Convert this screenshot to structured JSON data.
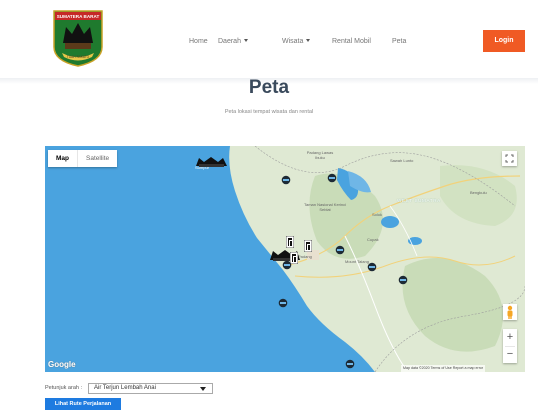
{
  "logo": {
    "banner_text": "SUMATERA BARAT",
    "ribbon_text": "TUAH SAKATO"
  },
  "nav": {
    "home": "Home",
    "daerah": "Daerah",
    "wisata": "Wisata",
    "rental": "Rental Mobil",
    "peta": "Peta",
    "login": "Login"
  },
  "page": {
    "title": "Peta",
    "subtitle": "Peta lokasi tempat wisata dan rental"
  },
  "map": {
    "type_map": "Map",
    "type_satellite": "Satellite",
    "zoom_in": "+",
    "zoom_out": "−",
    "google": "Google",
    "footer": "Map data ©2020   Terms of Use   Report a map error",
    "labels": {
      "padang_lawas": "Padang Lawas Ibuku",
      "sawah_lunto": "Sawah Lunto",
      "west_sumatra": "WEST SUMATRA",
      "nature_park": "Taman Nasional Kerinci Seblat",
      "solok": "Solok",
      "cupak": "Cupak",
      "mount_talang": "Mount Talang",
      "bengkulu": "Bengkulu",
      "padang": "Padang",
      "sumpur": "Sumpur"
    }
  },
  "directions": {
    "label": "Petunjuk arah :",
    "selected": "Air Terjun Lembah Anai",
    "button": "Lihat Rute Perjalanan"
  },
  "colors": {
    "accent_login": "#f05a24",
    "route_button": "#1e7be0",
    "sea": "#4aa3df",
    "land": "#dfe9d3"
  }
}
